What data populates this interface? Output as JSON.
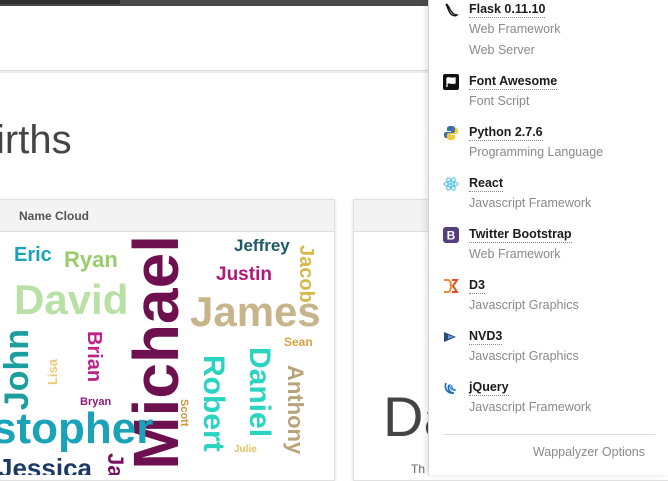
{
  "page": {
    "title": "irths",
    "big_fragment": "Da",
    "small_fragment": "Th"
  },
  "panel_left": {
    "title": "Name Cloud"
  },
  "word_cloud": {
    "words": [
      "Michael",
      "James",
      "David",
      "John",
      "Christopher",
      "Jessica",
      "Robert",
      "Daniel",
      "Anthony",
      "Justin",
      "Jeffrey",
      "Jacob",
      "Eric",
      "Ryan",
      "Brian",
      "Lisa",
      "Bryan",
      "Scott",
      "Sean",
      "Julie",
      "Ja"
    ],
    "colors": {
      "Michael": "#6e0f50",
      "James": "#c8b48a",
      "David": "#b9e0a5",
      "John": "#1a9e9e",
      "Christopher": "#1aa3b8",
      "Jessica": "#1b3a66",
      "Robert": "#2ad4c0",
      "Daniel": "#2ad4c0",
      "Anthony": "#b9a47a",
      "Justin": "#b0197a",
      "Jeffrey": "#1b5a66",
      "Jacob": "#d9b84a",
      "Eric": "#1aa3b8",
      "Ryan": "#9acd6a",
      "Brian": "#c0208a",
      "Lisa": "#f0c87a",
      "Bryan": "#8a1a7a",
      "Scott": "#c89a3a",
      "Sean": "#d9a040",
      "Julie": "#e3c060",
      "Ja": "#7a1060"
    }
  },
  "wappalyzer": {
    "apps": [
      {
        "name": "Flask 0.11.10",
        "categories": [
          "Web Framework",
          "Web Server"
        ],
        "icon": "flask-icon"
      },
      {
        "name": "Font Awesome",
        "categories": [
          "Font Script"
        ],
        "icon": "font-awesome-icon"
      },
      {
        "name": "Python 2.7.6",
        "categories": [
          "Programming Language"
        ],
        "icon": "python-icon"
      },
      {
        "name": "React",
        "categories": [
          "Javascript Framework"
        ],
        "icon": "react-icon"
      },
      {
        "name": "Twitter Bootstrap",
        "categories": [
          "Web Framework"
        ],
        "icon": "bootstrap-icon"
      },
      {
        "name": "D3",
        "categories": [
          "Javascript Graphics"
        ],
        "icon": "d3-icon"
      },
      {
        "name": "NVD3",
        "categories": [
          "Javascript Graphics"
        ],
        "icon": "nvd3-icon"
      },
      {
        "name": "jQuery",
        "categories": [
          "Javascript Framework"
        ],
        "icon": "jquery-icon"
      }
    ],
    "options_label": "Wappalyzer Options"
  }
}
